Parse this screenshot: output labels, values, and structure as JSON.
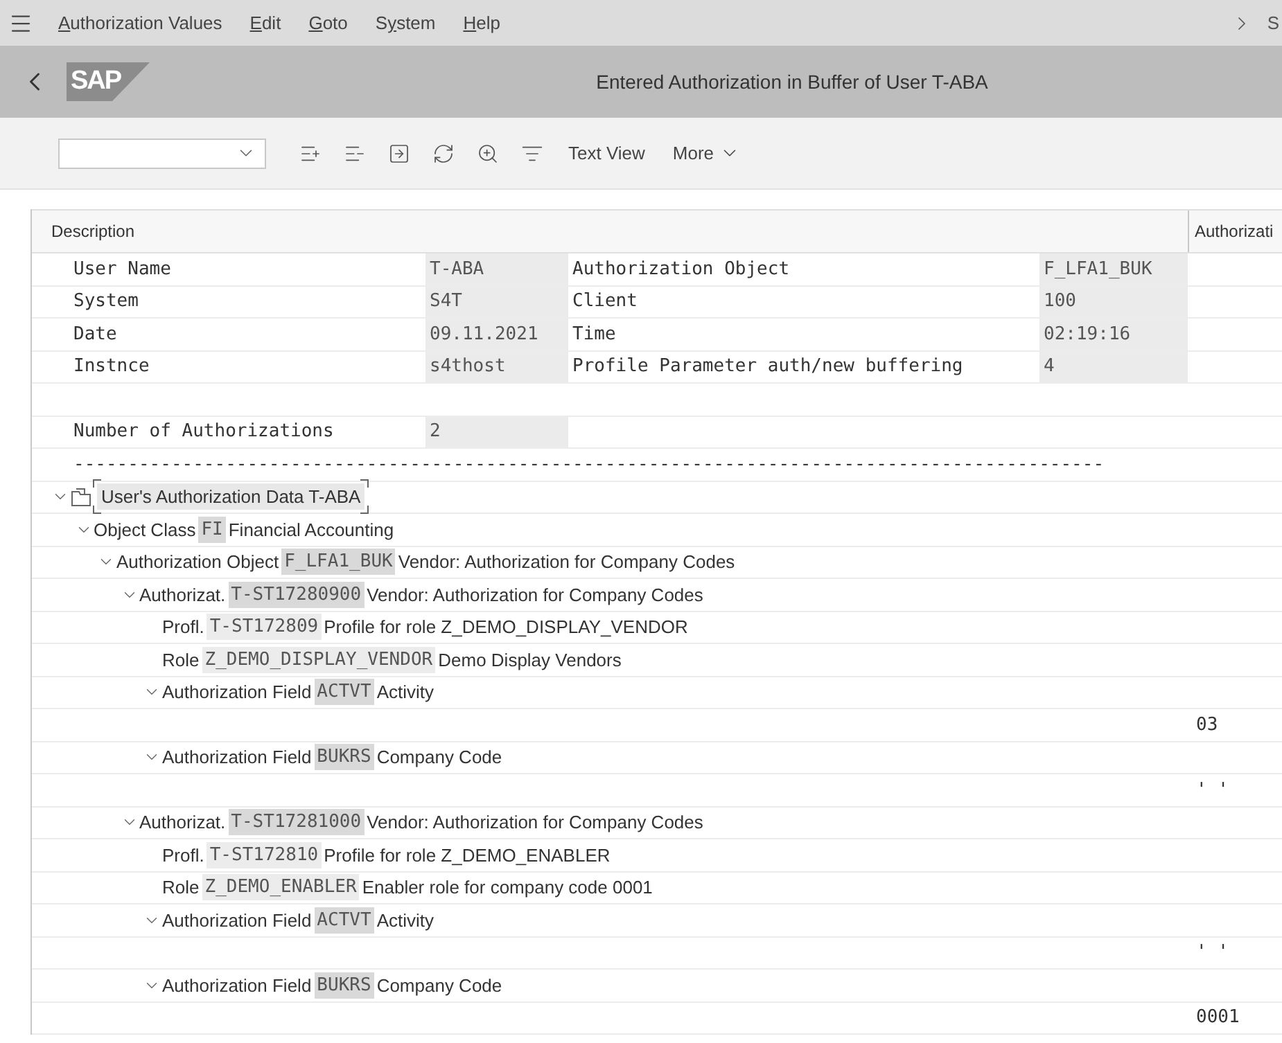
{
  "menu_bar": {
    "items": [
      {
        "mnemonic": "A",
        "after": "uthorization Values"
      },
      {
        "mnemonic": "E",
        "after": "dit"
      },
      {
        "mnemonic": "G",
        "after": "oto"
      },
      {
        "before": "S",
        "mnemonic": "y",
        "after": "stem"
      },
      {
        "mnemonic": "H",
        "after": "elp"
      }
    ],
    "overflow_text": "S"
  },
  "header": {
    "logo": "SAP",
    "title": "Entered Authorization in Buffer of User T-ABA"
  },
  "toolbar": {
    "text_button": "Text View",
    "more": "More"
  },
  "table": {
    "columns": [
      "Description",
      "Authorizati"
    ],
    "info_rows": [
      {
        "label": "User Name",
        "value": "T-ABA",
        "label2": "Authorization Object",
        "value2": "F_LFA1_BUK"
      },
      {
        "label": "System",
        "value": "S4T",
        "label2": "Client",
        "value2": "100"
      },
      {
        "label": "Date",
        "value": "09.11.2021",
        "label2": "Time",
        "value2": "02:19:16"
      },
      {
        "label": "Instnce",
        "value": "s4thost",
        "label2": "Profile Parameter auth/new buffering",
        "value2": "4"
      }
    ],
    "count_row": {
      "label": "Number of Authorizations",
      "value": "2"
    },
    "separator": "-----------------------------------------------------------------------------------------------",
    "tree": [
      {
        "kind": "root",
        "label": "User's Authorization Data T-ABA",
        "expanded": true,
        "focused": true,
        "children": [
          {
            "kind": "node",
            "label": "Object Class",
            "key": "FI",
            "text": "Financial Accounting",
            "expanded": true,
            "children": [
              {
                "kind": "node",
                "label": "Authorization Object",
                "key": "F_LFA1_BUK",
                "text": "Vendor: Authorization for Company Codes",
                "expanded": true,
                "children": [
                  {
                    "kind": "node",
                    "label": "Authorizat.",
                    "key": "T-ST17280900",
                    "text": "Vendor: Authorization for Company Codes",
                    "expanded": true,
                    "children": [
                      {
                        "kind": "info",
                        "label": "Profl.",
                        "key": "T-ST172809",
                        "text": "Profile for role Z_DEMO_DISPLAY_VENDOR"
                      },
                      {
                        "kind": "info",
                        "label": "Role",
                        "key": "Z_DEMO_DISPLAY_VENDOR",
                        "text": "Demo Display Vendors"
                      },
                      {
                        "kind": "node",
                        "label": "Authorization Field",
                        "key": "ACTVT",
                        "text": "Activity",
                        "expanded": true,
                        "children": [
                          {
                            "kind": "value",
                            "value": "03"
                          }
                        ]
                      },
                      {
                        "kind": "node",
                        "label": "Authorization Field",
                        "key": "BUKRS",
                        "text": "Company Code",
                        "expanded": true,
                        "children": [
                          {
                            "kind": "value",
                            "value": "' '"
                          }
                        ]
                      }
                    ]
                  },
                  {
                    "kind": "node",
                    "label": "Authorizat.",
                    "key": "T-ST17281000",
                    "text": "Vendor: Authorization for Company Codes",
                    "expanded": true,
                    "children": [
                      {
                        "kind": "info",
                        "label": "Profl.",
                        "key": "T-ST172810",
                        "text": "Profile for role Z_DEMO_ENABLER"
                      },
                      {
                        "kind": "info",
                        "label": "Role",
                        "key": "Z_DEMO_ENABLER",
                        "text": "Enabler role for company code 0001"
                      },
                      {
                        "kind": "node",
                        "label": "Authorization Field",
                        "key": "ACTVT",
                        "text": "Activity",
                        "expanded": true,
                        "children": [
                          {
                            "kind": "value",
                            "value": "' '"
                          }
                        ]
                      },
                      {
                        "kind": "node",
                        "label": "Authorization Field",
                        "key": "BUKRS",
                        "text": "Company Code",
                        "expanded": true,
                        "children": [
                          {
                            "kind": "value",
                            "value": "0001"
                          }
                        ]
                      }
                    ]
                  }
                ]
              }
            ]
          }
        ]
      }
    ]
  }
}
